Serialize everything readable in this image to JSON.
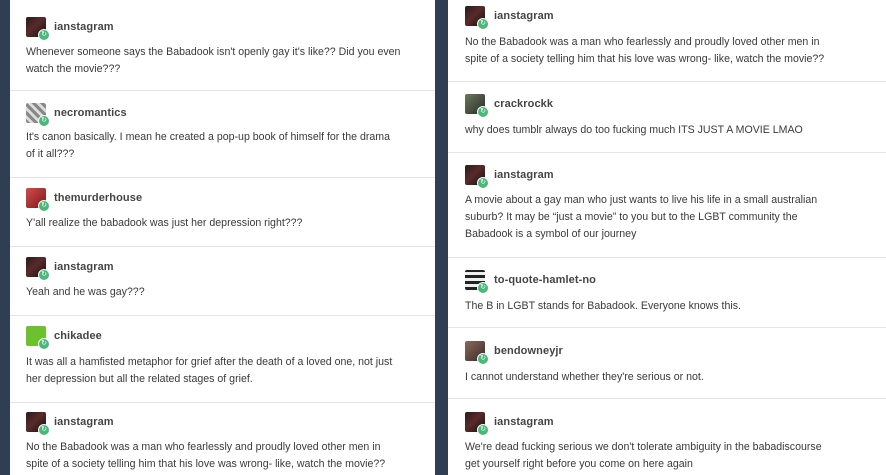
{
  "colors": {
    "background": "#2f3e52",
    "card": "#ffffff",
    "reblog_badge": "#4ab87a"
  },
  "left_posts": [
    {
      "username": "ianstagram",
      "avatar": "ianstagram-avatar",
      "text": [
        "Whenever someone says the Babadook isn't openly gay it's like?? Did you even",
        "watch the movie???"
      ]
    },
    {
      "username": "necromantics",
      "avatar": "necromantics-avatar",
      "text": [
        "It's canon basically. I mean he created a pop-up book of himself for the drama",
        "of it all???"
      ]
    },
    {
      "username": "themurderhouse",
      "avatar": "themurderhouse-avatar",
      "text": [
        "Y'all realize the babadook was just her depression right???"
      ]
    },
    {
      "username": "ianstagram",
      "avatar": "ianstagram-avatar",
      "text": [
        "Yeah and he was gay???"
      ]
    },
    {
      "username": "chikadee",
      "avatar": "chikadee-avatar",
      "text": [
        "It was all a hamfisted metaphor for grief after the death of a loved one, not just",
        "her depression but all the related stages of grief."
      ]
    },
    {
      "username": "ianstagram",
      "avatar": "ianstagram-avatar",
      "text": [
        "No the Babadook was a man who fearlessly and proudly loved other men in",
        "spite of a society telling him that his love was wrong- like, watch the movie??"
      ]
    }
  ],
  "right_posts": [
    {
      "username": "ianstagram",
      "avatar": "ianstagram-avatar",
      "text": [
        "No the Babadook was a man who fearlessly and proudly loved other men in",
        "spite of a society telling him that his love was wrong- like, watch the movie??"
      ]
    },
    {
      "username": "crackrockk",
      "avatar": "crackrockk-avatar",
      "text": [
        "why does tumblr always do too fucking much ITS JUST A MOVIE LMAO"
      ]
    },
    {
      "username": "ianstagram",
      "avatar": "ianstagram-avatar",
      "text": [
        "A movie about a gay man who just wants to live his life in a small australian",
        "suburb? It may be “just a movie” to you but to the LGBT community the",
        "Babadook is a symbol of our journey"
      ]
    },
    {
      "username": "to-quote-hamlet-no",
      "avatar": "to-quote-hamlet-no-avatar",
      "text": [
        "The B in LGBT stands for Babadook. Everyone knows this."
      ]
    },
    {
      "username": "bendowneyjr",
      "avatar": "bendowneyjr-avatar",
      "text": [
        "I cannot understand whether they're serious or not."
      ]
    },
    {
      "username": "ianstagram",
      "avatar": "ianstagram-avatar",
      "text": [
        "We're dead fucking serious we don't tolerate ambiguity in the babadiscourse",
        "get yourself right before you come on here again"
      ]
    }
  ]
}
